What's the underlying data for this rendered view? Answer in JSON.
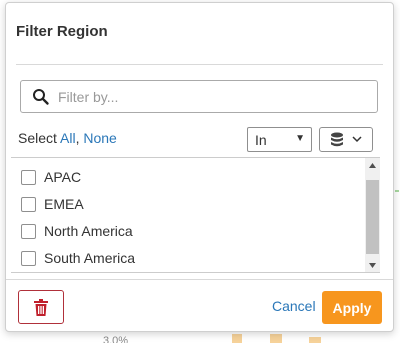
{
  "dialog": {
    "title": "Filter Region"
  },
  "search": {
    "placeholder": "Filter by...",
    "value": ""
  },
  "selection": {
    "prefix": "Select ",
    "all_label": "All",
    "separator": ", ",
    "none_label": "None"
  },
  "operator": {
    "selected": "In"
  },
  "items": [
    {
      "label": "APAC",
      "checked": false
    },
    {
      "label": "EMEA",
      "checked": false
    },
    {
      "label": "North America",
      "checked": false
    },
    {
      "label": "South America",
      "checked": false
    }
  ],
  "footer": {
    "cancel_label": "Cancel",
    "apply_label": "Apply"
  },
  "background": {
    "axis_text": "3.0%"
  },
  "colors": {
    "accent": "#f7961e",
    "link": "#2a77b8",
    "danger": "#b0303a"
  },
  "icons": {
    "search": "search-icon",
    "database": "database-icon",
    "chevron": "chevron-down-icon",
    "trash": "trash-icon"
  }
}
